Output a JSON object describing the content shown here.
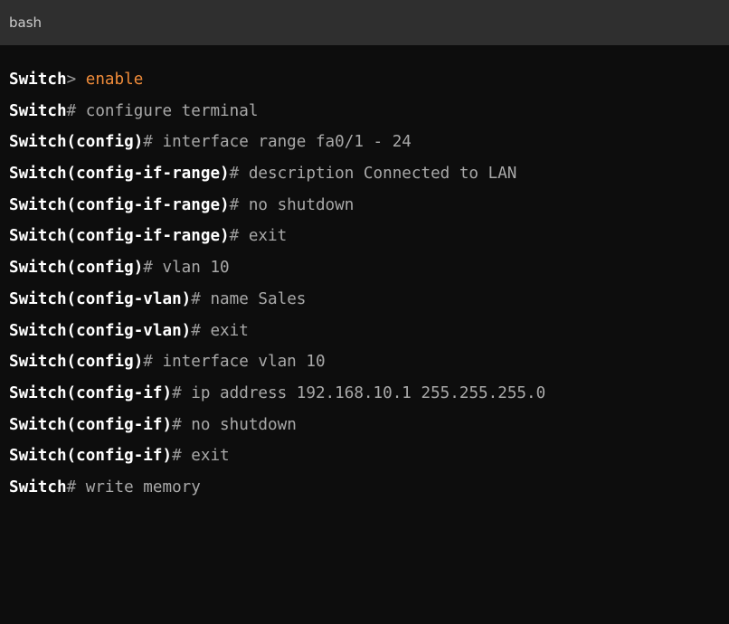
{
  "header": {
    "language": "bash"
  },
  "lines": [
    {
      "prompt": "Switch",
      "symbol": ">",
      "command": "enable",
      "accent": true
    },
    {
      "prompt": "Switch",
      "symbol": "#",
      "command": "configure terminal",
      "accent": false
    },
    {
      "prompt": "Switch(config)",
      "symbol": "#",
      "command": "interface range fa0/1 - 24",
      "accent": false
    },
    {
      "prompt": "Switch(config-if-range)",
      "symbol": "#",
      "command": "description Connected to LAN",
      "accent": false
    },
    {
      "prompt": "Switch(config-if-range)",
      "symbol": "#",
      "command": "no shutdown",
      "accent": false
    },
    {
      "prompt": "Switch(config-if-range)",
      "symbol": "#",
      "command": "exit",
      "accent": false
    },
    {
      "prompt": "Switch(config)",
      "symbol": "#",
      "command": "vlan 10",
      "accent": false
    },
    {
      "prompt": "Switch(config-vlan)",
      "symbol": "#",
      "command": "name Sales",
      "accent": false
    },
    {
      "prompt": "Switch(config-vlan)",
      "symbol": "#",
      "command": "exit",
      "accent": false
    },
    {
      "prompt": "Switch(config)",
      "symbol": "#",
      "command": "interface vlan 10",
      "accent": false
    },
    {
      "prompt": "Switch(config-if)",
      "symbol": "#",
      "command": "ip address 192.168.10.1 255.255.255.0",
      "accent": false
    },
    {
      "prompt": "Switch(config-if)",
      "symbol": "#",
      "command": "no shutdown",
      "accent": false
    },
    {
      "prompt": "Switch(config-if)",
      "symbol": "#",
      "command": "exit",
      "accent": false
    },
    {
      "prompt": "Switch",
      "symbol": "#",
      "command": "write memory",
      "accent": false
    }
  ],
  "colors": {
    "background": "#0d0d0d",
    "header": "#2f2f2f",
    "prompt": "#ffffff",
    "command": "#a9a9a9",
    "accent": "#f08c3a"
  }
}
